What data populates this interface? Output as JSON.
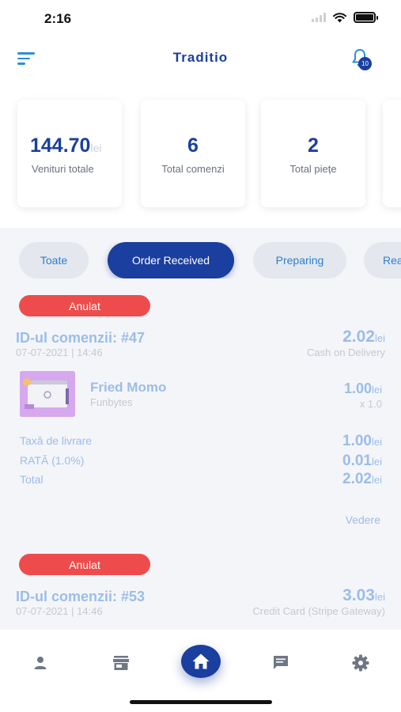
{
  "status_bar": {
    "time": "2:16"
  },
  "header": {
    "title": "Traditio",
    "notification_count": "10"
  },
  "stats": [
    {
      "value": "144.70",
      "unit": "lei",
      "label": "Venituri totale"
    },
    {
      "value": "6",
      "label": "Total comenzi"
    },
    {
      "value": "2",
      "label": "Total piețe"
    }
  ],
  "filters": [
    {
      "label": "Toate",
      "active": false
    },
    {
      "label": "Order Received",
      "active": true
    },
    {
      "label": "Preparing",
      "active": false
    },
    {
      "label": "Rea",
      "active": false
    }
  ],
  "orders": [
    {
      "status": "Anulat",
      "id_label": "ID-ul comenzii: #47",
      "date": "07-07-2021 | 14:46",
      "total": "2.02",
      "currency": "lei",
      "payment": "Cash on Delivery",
      "item": {
        "name": "Fried Momo",
        "brand": "Funbytes",
        "price": "1.00",
        "currency": "lei",
        "qty": "x 1.0"
      },
      "summary": [
        {
          "label": "Taxă de livrare",
          "value": "1.00",
          "currency": "lei"
        },
        {
          "label": "RATĂ (1.0%)",
          "value": "0.01",
          "currency": "lei"
        },
        {
          "label": "Total",
          "value": "2.02",
          "currency": "lei"
        }
      ],
      "view_label": "Vedere"
    },
    {
      "status": "Anulat",
      "id_label": "ID-ul comenzii: #53",
      "date": "07-07-2021 | 14:46",
      "total": "3.03",
      "currency": "lei",
      "payment": "Credit Card (Stripe Gateway)"
    }
  ],
  "bottom_nav": [
    {
      "icon": "person-icon"
    },
    {
      "icon": "store-icon"
    },
    {
      "icon": "home-icon",
      "active": true
    },
    {
      "icon": "chat-icon"
    },
    {
      "icon": "gear-icon"
    }
  ],
  "colors": {
    "primary": "#1b3f9e",
    "accent": "#2a8fd8",
    "cancel": "#ee4c4c",
    "faded_text": "#9bbde8"
  }
}
